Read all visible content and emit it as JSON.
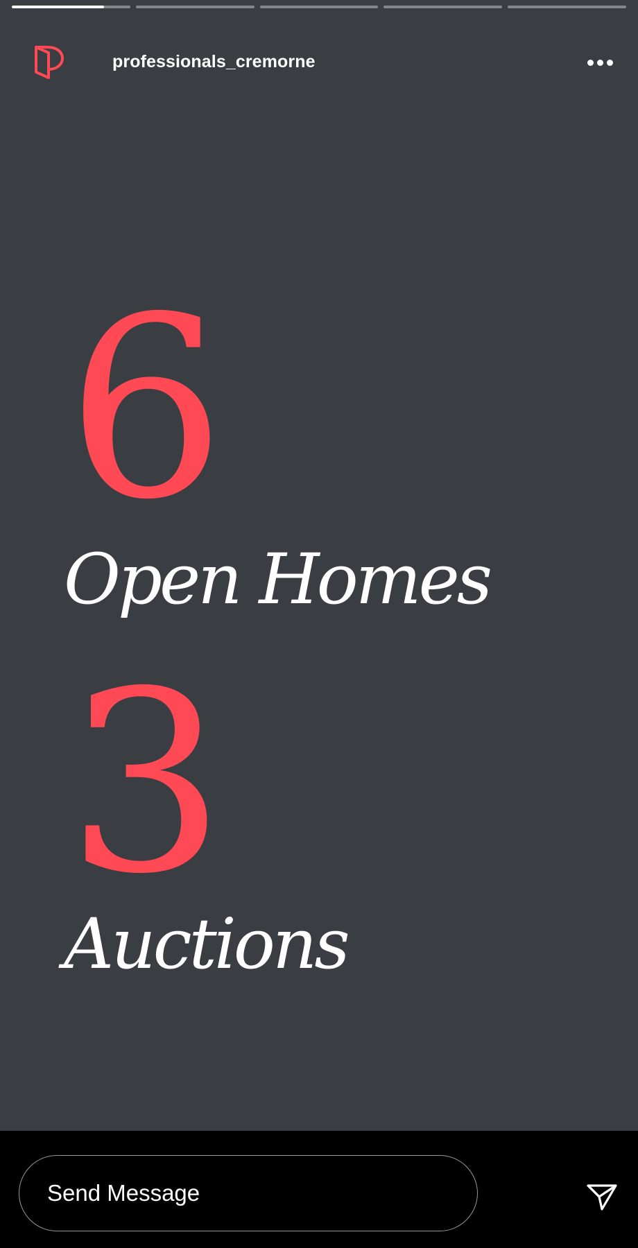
{
  "progress": {
    "segments": [
      {
        "filled": 0.78
      },
      {
        "filled": 0
      },
      {
        "filled": 0
      },
      {
        "filled": 0
      },
      {
        "filled": 0
      }
    ]
  },
  "header": {
    "username": "professionals_cremorne",
    "avatar_icon": "professionals-logo-icon",
    "more_icon": "more-dots-icon"
  },
  "stats": [
    {
      "number": "6",
      "label": "Open Homes"
    },
    {
      "number": "3",
      "label": "Auctions"
    }
  ],
  "composer": {
    "placeholder": "Send Message",
    "send_icon": "send-paper-plane-icon"
  },
  "colors": {
    "story_background": "#3a3d42",
    "accent": "#ff4a55",
    "bar_background": "#000000",
    "text": "#ffffff"
  }
}
